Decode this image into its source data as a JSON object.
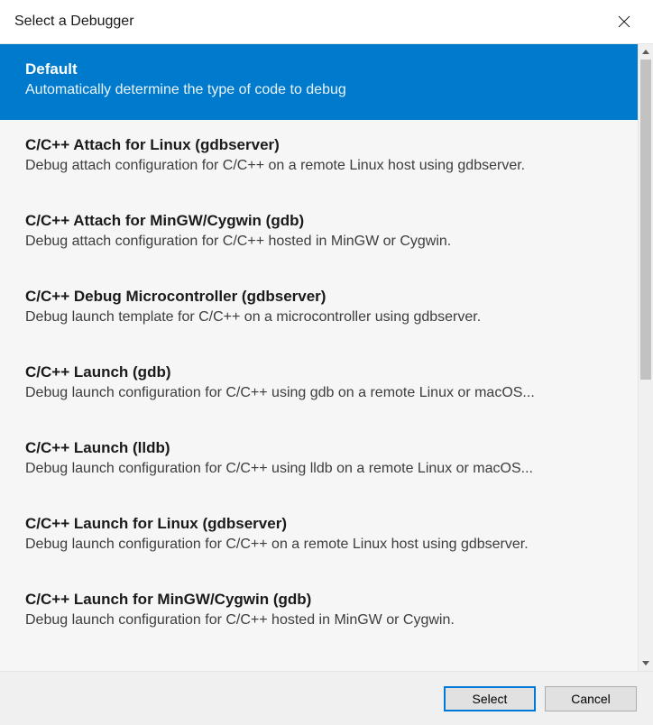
{
  "window": {
    "title": "Select a Debugger"
  },
  "items": [
    {
      "title": "Default",
      "desc": "Automatically determine the type of code to debug",
      "selected": true
    },
    {
      "title": "C/C++ Attach for Linux (gdbserver)",
      "desc": "Debug attach configuration for C/C++ on a remote Linux host using gdbserver.",
      "selected": false
    },
    {
      "title": "C/C++ Attach for MinGW/Cygwin (gdb)",
      "desc": "Debug attach configuration for C/C++ hosted in MinGW or Cygwin.",
      "selected": false
    },
    {
      "title": "C/C++ Debug Microcontroller (gdbserver)",
      "desc": "Debug launch template for C/C++ on a microcontroller using gdbserver.",
      "selected": false
    },
    {
      "title": "C/C++ Launch (gdb)",
      "desc": "Debug launch configuration for C/C++ using gdb on a remote Linux or macOS...",
      "selected": false
    },
    {
      "title": "C/C++ Launch (lldb)",
      "desc": "Debug launch configuration for C/C++ using lldb on a remote Linux or macOS...",
      "selected": false
    },
    {
      "title": "C/C++ Launch for Linux (gdbserver)",
      "desc": "Debug launch configuration for C/C++ on a remote Linux host using gdbserver.",
      "selected": false
    },
    {
      "title": "C/C++ Launch for MinGW/Cygwin (gdb)",
      "desc": "Debug launch configuration for C/C++ hosted in MinGW or Cygwin.",
      "selected": false
    }
  ],
  "footer": {
    "select_label": "Select",
    "cancel_label": "Cancel"
  }
}
